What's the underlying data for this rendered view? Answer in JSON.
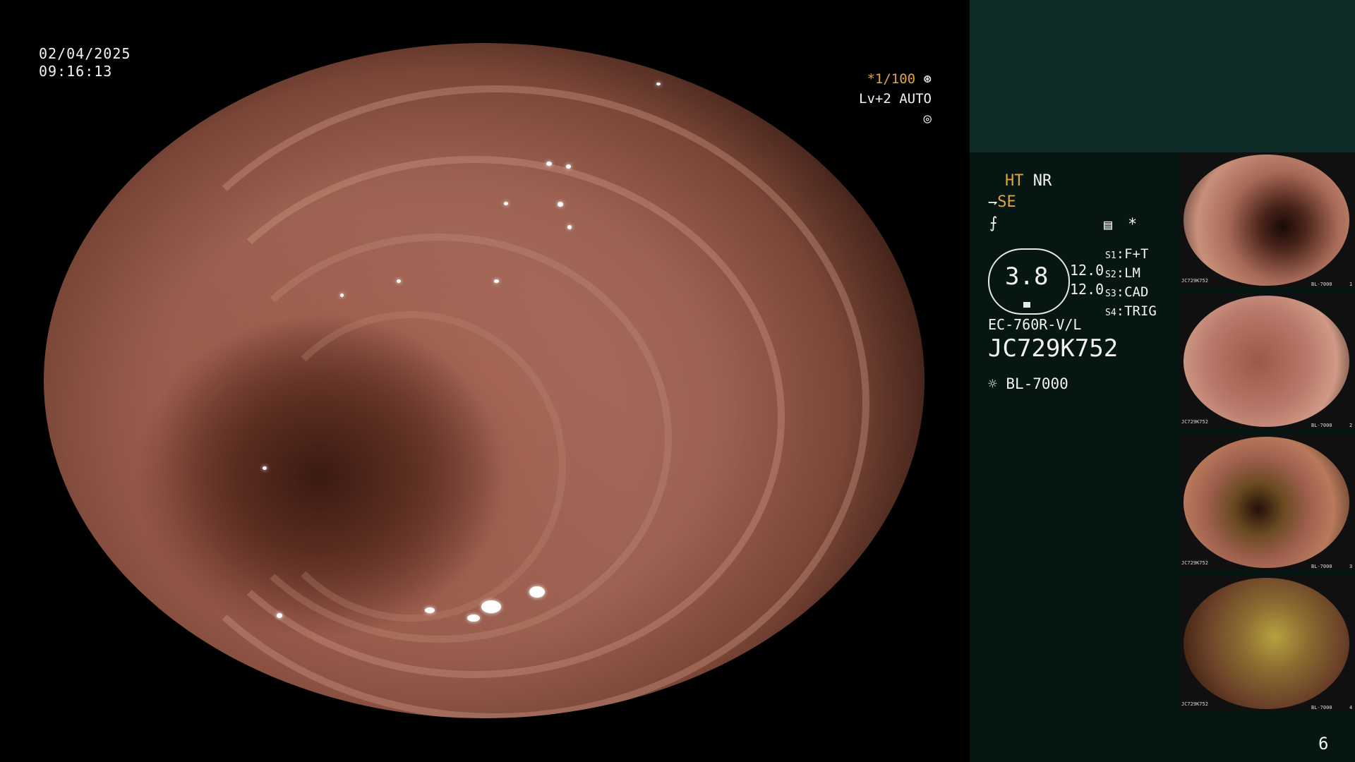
{
  "overlay": {
    "date": "02/04/2025",
    "time": "09:16:13",
    "shutter": "*1/100",
    "level": "Lv+2 AUTO"
  },
  "panel": {
    "ht": "HT",
    "nr": "NR",
    "se": "SE",
    "asterisk": "*",
    "lens_value": "3.8",
    "value_1": "12.0",
    "value_2": "12.0",
    "switches": [
      {
        "key": "S1",
        "value": "F+T"
      },
      {
        "key": "S2",
        "value": "LM"
      },
      {
        "key": "S3",
        "value": "CAD"
      },
      {
        "key": "S4",
        "value": "TRIG"
      }
    ],
    "scope_model": "EC-760R-V/L",
    "scope_serial": "JC729K752",
    "light_source": "BL-7000",
    "page_number": "6",
    "accent_color": "#e3a23f",
    "panel_color": "#061713",
    "panel_top_color": "#0d2c27"
  },
  "thumbnails": [
    {
      "label": "JC729K752",
      "footer": "BL-7000",
      "index": "1"
    },
    {
      "label": "JC729K752",
      "footer": "BL-7000",
      "index": "2"
    },
    {
      "label": "JC729K752",
      "footer": "BL-7000",
      "index": "3"
    },
    {
      "label": "JC729K752",
      "footer": "BL-7000",
      "index": "4"
    }
  ]
}
